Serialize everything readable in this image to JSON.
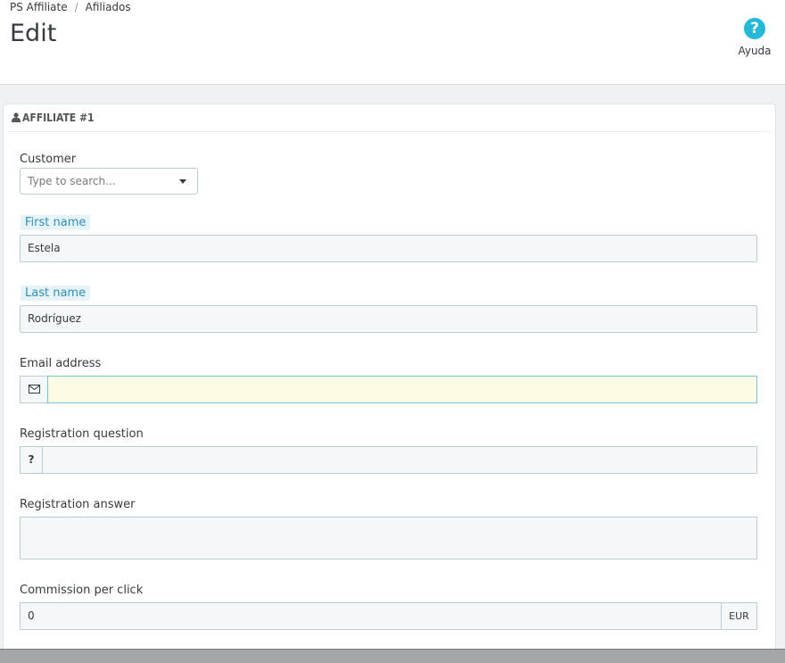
{
  "breadcrumb": {
    "parent": "PS Affiliate",
    "separator": "/",
    "current": "Afiliados"
  },
  "page_title": "Edit",
  "help": {
    "icon": "question-circle-icon",
    "label": "Ayuda"
  },
  "panel": {
    "heading_icon": "user-icon",
    "heading": "AFFILIATE #1"
  },
  "form": {
    "customer": {
      "label": "Customer",
      "placeholder": "Type to search..."
    },
    "first_name": {
      "label": "First name",
      "value": "Estela"
    },
    "last_name": {
      "label": "Last name",
      "value": "Rodríguez"
    },
    "email": {
      "label": "Email address",
      "icon": "envelope-icon",
      "value": ""
    },
    "registration_question": {
      "label": "Registration question",
      "addon": "?",
      "value": ""
    },
    "registration_answer": {
      "label": "Registration answer",
      "value": ""
    },
    "commission_per_click": {
      "label": "Commission per click",
      "value": "0",
      "suffix": "EUR"
    }
  },
  "colors": {
    "accent": "#25b9d7",
    "focus_bg": "#fefbe5",
    "label_highlight": "#e6f4fa"
  }
}
